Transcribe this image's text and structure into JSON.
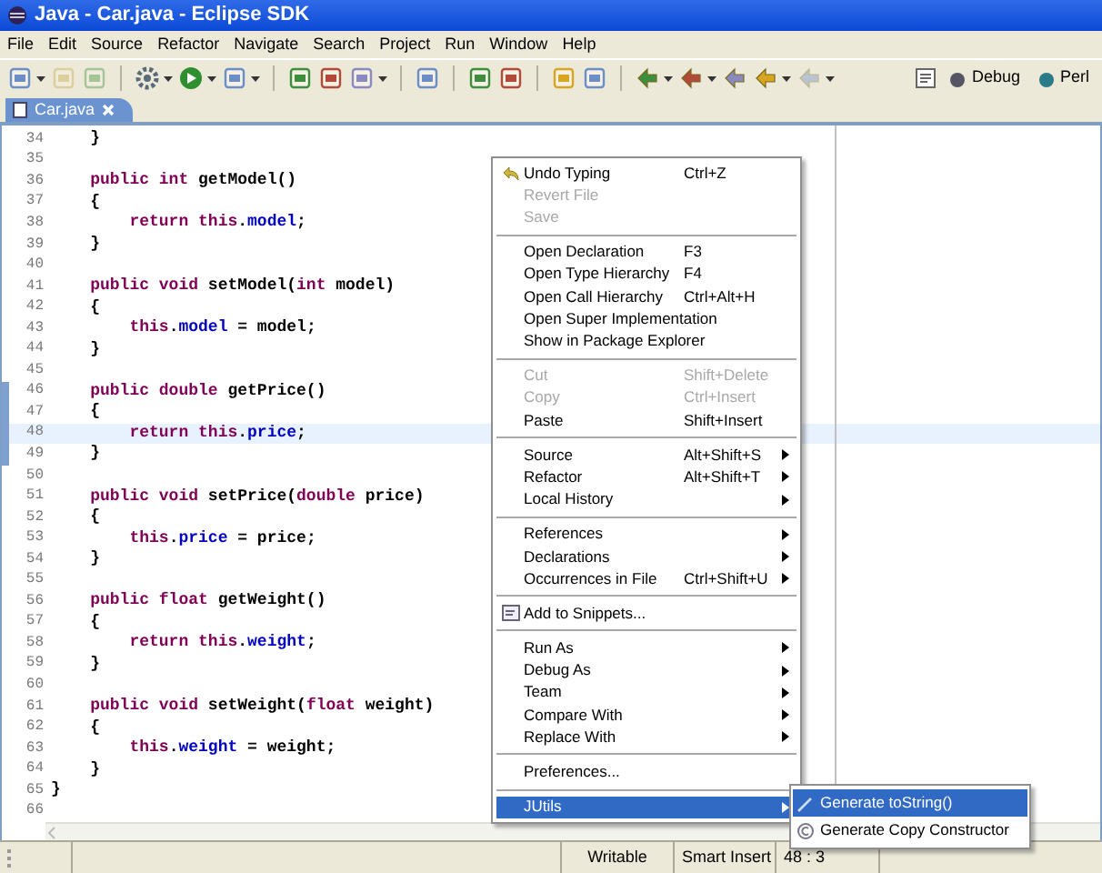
{
  "window": {
    "title": "Java - Car.java - Eclipse SDK"
  },
  "menu_bar": [
    "File",
    "Edit",
    "Source",
    "Refactor",
    "Navigate",
    "Search",
    "Project",
    "Run",
    "Window",
    "Help"
  ],
  "perspectives": [
    {
      "label": "Debug"
    },
    {
      "label": "Perl"
    }
  ],
  "tabs": [
    {
      "label": "Car.java",
      "selected": true
    }
  ],
  "editor": {
    "lines": [
      {
        "number": "34",
        "current": false,
        "range": false,
        "tokens": [
          {
            "kind": "plain",
            "text": "    }"
          }
        ]
      },
      {
        "number": "35",
        "current": false,
        "range": false
      },
      {
        "number": "36",
        "current": false,
        "range": false,
        "tokens": [
          {
            "kind": "keyword",
            "text": "    public int"
          },
          {
            "kind": "plain",
            "text": " getModel()"
          }
        ]
      },
      {
        "number": "37",
        "current": false,
        "range": false,
        "tokens": [
          {
            "kind": "plain",
            "text": "    {"
          }
        ]
      },
      {
        "number": "38",
        "current": false,
        "range": false,
        "tokens": [
          {
            "kind": "keyword",
            "text": "        return this"
          },
          {
            "kind": "plain",
            "text": "."
          },
          {
            "kind": "field",
            "text": "model"
          },
          {
            "kind": "plain",
            "text": ";"
          }
        ]
      },
      {
        "number": "39",
        "current": false,
        "range": false,
        "tokens": [
          {
            "kind": "plain",
            "text": "    }"
          }
        ]
      },
      {
        "number": "40",
        "current": false,
        "range": false
      },
      {
        "number": "41",
        "current": false,
        "range": false,
        "tokens": [
          {
            "kind": "keyword",
            "text": "    public void"
          },
          {
            "kind": "plain",
            "text": " setModel("
          },
          {
            "kind": "keyword",
            "text": "int"
          },
          {
            "kind": "plain",
            "text": " model)"
          }
        ]
      },
      {
        "number": "42",
        "current": false,
        "range": false,
        "tokens": [
          {
            "kind": "plain",
            "text": "    {"
          }
        ]
      },
      {
        "number": "43",
        "current": false,
        "range": false,
        "tokens": [
          {
            "kind": "keyword",
            "text": "        this"
          },
          {
            "kind": "plain",
            "text": "."
          },
          {
            "kind": "field",
            "text": "model"
          },
          {
            "kind": "plain",
            "text": " = model;"
          }
        ]
      },
      {
        "number": "44",
        "current": false,
        "range": false,
        "tokens": [
          {
            "kind": "plain",
            "text": "    }"
          }
        ]
      },
      {
        "number": "45",
        "current": false,
        "range": false
      },
      {
        "number": "46",
        "current": false,
        "range": true,
        "tokens": [
          {
            "kind": "keyword",
            "text": "    public double"
          },
          {
            "kind": "plain",
            "text": " getPrice()"
          }
        ]
      },
      {
        "number": "47",
        "current": false,
        "range": true,
        "tokens": [
          {
            "kind": "plain",
            "text": "    {"
          }
        ]
      },
      {
        "number": "48",
        "current": true,
        "range": true,
        "tokens": [
          {
            "kind": "keyword",
            "text": "        return this"
          },
          {
            "kind": "plain",
            "text": "."
          },
          {
            "kind": "field",
            "text": "price"
          },
          {
            "kind": "plain",
            "text": ";"
          }
        ]
      },
      {
        "number": "49",
        "current": false,
        "range": true,
        "tokens": [
          {
            "kind": "plain",
            "text": "    }"
          }
        ]
      },
      {
        "number": "50",
        "current": false,
        "range": false
      },
      {
        "number": "51",
        "current": false,
        "range": false,
        "tokens": [
          {
            "kind": "keyword",
            "text": "    public void"
          },
          {
            "kind": "plain",
            "text": " setPrice("
          },
          {
            "kind": "keyword",
            "text": "double"
          },
          {
            "kind": "plain",
            "text": " price)"
          }
        ]
      },
      {
        "number": "52",
        "current": false,
        "range": false,
        "tokens": [
          {
            "kind": "plain",
            "text": "    {"
          }
        ]
      },
      {
        "number": "53",
        "current": false,
        "range": false,
        "tokens": [
          {
            "kind": "keyword",
            "text": "        this"
          },
          {
            "kind": "plain",
            "text": "."
          },
          {
            "kind": "field",
            "text": "price"
          },
          {
            "kind": "plain",
            "text": " = price;"
          }
        ]
      },
      {
        "number": "54",
        "current": false,
        "range": false,
        "tokens": [
          {
            "kind": "plain",
            "text": "    }"
          }
        ]
      },
      {
        "number": "55",
        "current": false,
        "range": false
      },
      {
        "number": "56",
        "current": false,
        "range": false,
        "tokens": [
          {
            "kind": "keyword",
            "text": "    public float"
          },
          {
            "kind": "plain",
            "text": " getWeight()"
          }
        ]
      },
      {
        "number": "57",
        "current": false,
        "range": false,
        "tokens": [
          {
            "kind": "plain",
            "text": "    {"
          }
        ]
      },
      {
        "number": "58",
        "current": false,
        "range": false,
        "tokens": [
          {
            "kind": "keyword",
            "text": "        return this"
          },
          {
            "kind": "plain",
            "text": "."
          },
          {
            "kind": "field",
            "text": "weight"
          },
          {
            "kind": "plain",
            "text": ";"
          }
        ]
      },
      {
        "number": "59",
        "current": false,
        "range": false,
        "tokens": [
          {
            "kind": "plain",
            "text": "    }"
          }
        ]
      },
      {
        "number": "60",
        "current": false,
        "range": false
      },
      {
        "number": "61",
        "current": false,
        "range": false,
        "tokens": [
          {
            "kind": "keyword",
            "text": "    public void"
          },
          {
            "kind": "plain",
            "text": " setWeight("
          },
          {
            "kind": "keyword",
            "text": "float"
          },
          {
            "kind": "plain",
            "text": " weight)"
          }
        ]
      },
      {
        "number": "62",
        "current": false,
        "range": false,
        "tokens": [
          {
            "kind": "plain",
            "text": "    {"
          }
        ]
      },
      {
        "number": "63",
        "current": false,
        "range": false,
        "tokens": [
          {
            "kind": "keyword",
            "text": "        this"
          },
          {
            "kind": "plain",
            "text": "."
          },
          {
            "kind": "field",
            "text": "weight"
          },
          {
            "kind": "plain",
            "text": " = weight;"
          }
        ]
      },
      {
        "number": "64",
        "current": false,
        "range": false,
        "tokens": [
          {
            "kind": "plain",
            "text": "    }"
          }
        ]
      },
      {
        "number": "65",
        "current": false,
        "range": false,
        "tokens": [
          {
            "kind": "plain",
            "text": "}"
          }
        ]
      },
      {
        "number": "66",
        "current": false,
        "range": false
      }
    ]
  },
  "context_menu": {
    "groups": [
      [
        {
          "label": "Undo Typing",
          "shortcut": "Ctrl+Z",
          "kind": "icon",
          "disabled": false,
          "submenu": false,
          "selected": false
        },
        {
          "label": "Revert File",
          "kind": "plain",
          "disabled": true,
          "submenu": false,
          "selected": false
        },
        {
          "label": "Save",
          "kind": "plain",
          "disabled": true,
          "submenu": false,
          "selected": false
        }
      ],
      [
        {
          "label": "Open Declaration",
          "shortcut": "F3",
          "kind": "plain",
          "disabled": false,
          "submenu": false,
          "selected": false
        },
        {
          "label": "Open Type Hierarchy",
          "shortcut": "F4",
          "kind": "plain",
          "disabled": false,
          "submenu": false,
          "selected": false
        },
        {
          "label": "Open Call Hierarchy",
          "shortcut": "Ctrl+Alt+H",
          "kind": "plain",
          "disabled": false,
          "submenu": false,
          "selected": false
        },
        {
          "label": "Open Super Implementation",
          "kind": "plain",
          "disabled": false,
          "submenu": false,
          "selected": false
        },
        {
          "label": "Show in Package Explorer",
          "kind": "plain",
          "disabled": false,
          "submenu": false,
          "selected": false
        }
      ],
      [
        {
          "label": "Cut",
          "shortcut": "Shift+Delete",
          "kind": "plain",
          "disabled": true,
          "submenu": false,
          "selected": false
        },
        {
          "label": "Copy",
          "shortcut": "Ctrl+Insert",
          "kind": "plain",
          "disabled": true,
          "submenu": false,
          "selected": false
        },
        {
          "label": "Paste",
          "shortcut": "Shift+Insert",
          "kind": "plain",
          "disabled": false,
          "submenu": false,
          "selected": false
        }
      ],
      [
        {
          "label": "Source",
          "shortcut": "Alt+Shift+S",
          "kind": "plain",
          "disabled": false,
          "submenu": true,
          "selected": false
        },
        {
          "label": "Refactor",
          "shortcut": "Alt+Shift+T",
          "kind": "plain",
          "disabled": false,
          "submenu": true,
          "selected": false
        },
        {
          "label": "Local History",
          "kind": "plain",
          "disabled": false,
          "submenu": true,
          "selected": false
        }
      ],
      [
        {
          "label": "References",
          "kind": "plain",
          "disabled": false,
          "submenu": true,
          "selected": false
        },
        {
          "label": "Declarations",
          "kind": "plain",
          "disabled": false,
          "submenu": true,
          "selected": false
        },
        {
          "label": "Occurrences in File",
          "shortcut": "Ctrl+Shift+U",
          "kind": "plain",
          "disabled": false,
          "submenu": true,
          "selected": false
        }
      ],
      [
        {
          "label": "Add to Snippets...",
          "kind": "icon",
          "disabled": false,
          "submenu": false,
          "selected": false
        }
      ],
      [
        {
          "label": "Run As",
          "kind": "plain",
          "disabled": false,
          "submenu": true,
          "selected": false
        },
        {
          "label": "Debug As",
          "kind": "plain",
          "disabled": false,
          "submenu": true,
          "selected": false
        },
        {
          "label": "Team",
          "kind": "plain",
          "disabled": false,
          "submenu": true,
          "selected": false
        },
        {
          "label": "Compare With",
          "kind": "plain",
          "disabled": false,
          "submenu": true,
          "selected": false
        },
        {
          "label": "Replace With",
          "kind": "plain",
          "disabled": false,
          "submenu": true,
          "selected": false
        }
      ],
      [
        {
          "label": "Preferences...",
          "kind": "plain",
          "disabled": false,
          "submenu": false,
          "selected": false
        }
      ],
      [
        {
          "label": "JUtils",
          "kind": "plain",
          "disabled": false,
          "submenu": true,
          "selected": true
        }
      ]
    ]
  },
  "submenu": [
    {
      "label": "Generate toString()",
      "selected": true
    },
    {
      "label": "Generate Copy Constructor",
      "selected": false
    }
  ],
  "status_bar": [
    "Writable",
    "Smart Insert",
    "48 : 3"
  ]
}
